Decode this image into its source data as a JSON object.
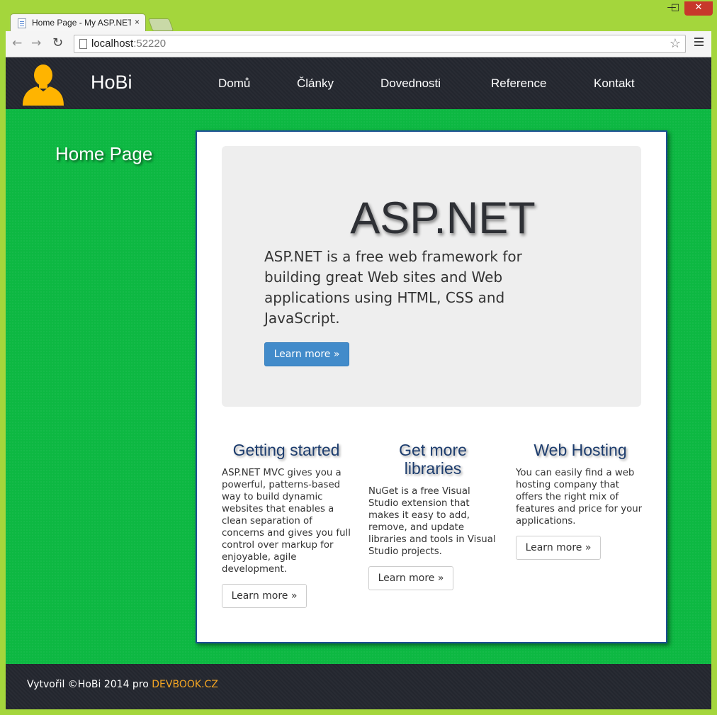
{
  "browser": {
    "tab_title": "Home Page - My ASP.NET",
    "tab_close": "×",
    "url_host": "localhost",
    "url_port": ":52220",
    "icons": [
      "back-icon",
      "forward-icon",
      "reload-icon",
      "page-icon",
      "star-icon",
      "menu-icon",
      "minimize-icon",
      "maximize-icon",
      "close-icon"
    ]
  },
  "header": {
    "brand": "HoBi",
    "nav": [
      {
        "label": "Domů"
      },
      {
        "label": "Články"
      },
      {
        "label": "Dovednosti"
      },
      {
        "label": "Reference"
      },
      {
        "label": "Kontakt"
      }
    ],
    "logo_color": "#ffb400"
  },
  "sidebar": {
    "page_title": "Home Page"
  },
  "jumbotron": {
    "title": "ASP.NET",
    "lead": "ASP.NET is a free web framework for building great Web sites and Web applications using HTML, CSS and JavaScript.",
    "button": "Learn more »"
  },
  "columns": [
    {
      "heading": "Getting started",
      "text": "ASP.NET MVC gives you a powerful, patterns-based way to build dynamic websites that enables a clean separation of concerns and gives you full control over markup for enjoyable, agile development.",
      "button": "Learn more »"
    },
    {
      "heading": "Get more libraries",
      "text": "NuGet is a free Visual Studio extension that makes it easy to add, remove, and update libraries and tools in Visual Studio projects.",
      "button": "Learn more »"
    },
    {
      "heading": "Web Hosting",
      "text": "You can easily find a web hosting company that offers the right mix of features and price for your applications.",
      "button": "Learn more »"
    }
  ],
  "footer": {
    "text": "Vytvořil ©HoBi 2014 pro ",
    "link": "DEVBOOK.CZ"
  },
  "colors": {
    "accent_green": "#0fb443",
    "header_dark": "#252830",
    "primary_button": "#428bca",
    "footer_link": "#f5a623",
    "panel_border": "#1c4f93"
  }
}
